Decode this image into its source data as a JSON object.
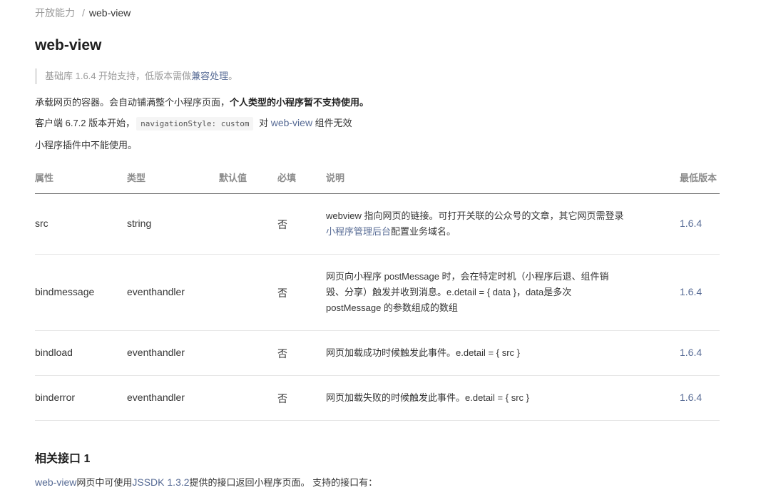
{
  "breadcrumb": {
    "parent": "开放能力",
    "separator": "/",
    "current": "web-view"
  },
  "title": "web-view",
  "note": {
    "prefix": "基础库 1.6.4 开始支持，低版本需做",
    "link": "兼容处理",
    "suffix": "。"
  },
  "para1": {
    "text": "承载网页的容器。会自动铺满整个小程序页面，",
    "bold": "个人类型的小程序暂不支持使用。"
  },
  "para2": {
    "prefix": "客户端 6.7.2 版本开始，",
    "code": "navigationStyle: custom",
    "mid": " 对 ",
    "link": "web-view",
    "suffix": " 组件无效"
  },
  "para3": "小程序插件中不能使用。",
  "table": {
    "headers": {
      "attr": "属性",
      "type": "类型",
      "default": "默认值",
      "required": "必填",
      "desc": "说明",
      "version": "最低版本"
    },
    "rows": [
      {
        "attr": "src",
        "type": "string",
        "default": "",
        "required": "否",
        "desc_line1": "webview 指向网页的链接。可打开关联的公众号的文章，其它网页需登录",
        "desc_link": "小程序管理后台",
        "desc_line2": "配置业务域名。",
        "version": "1.6.4"
      },
      {
        "attr": "bindmessage",
        "type": "eventhandler",
        "default": "",
        "required": "否",
        "desc": "网页向小程序 postMessage 时，会在特定时机（小程序后退、组件销毁、分享）触发并收到消息。e.detail = { data }，data是多次 postMessage 的参数组成的数组",
        "version": "1.6.4"
      },
      {
        "attr": "bindload",
        "type": "eventhandler",
        "default": "",
        "required": "否",
        "desc": "网页加载成功时候触发此事件。e.detail = { src }",
        "version": "1.6.4"
      },
      {
        "attr": "binderror",
        "type": "eventhandler",
        "default": "",
        "required": "否",
        "desc": "网页加载失败的时候触发此事件。e.detail = { src }",
        "version": "1.6.4"
      }
    ]
  },
  "section": {
    "title": "相关接口 1"
  },
  "para4": {
    "link1": "web-view",
    "text1": "网页中可使用",
    "link2": "JSSDK 1.3.2",
    "text2": "提供的接口返回小程序页面。 支持的接口有："
  }
}
